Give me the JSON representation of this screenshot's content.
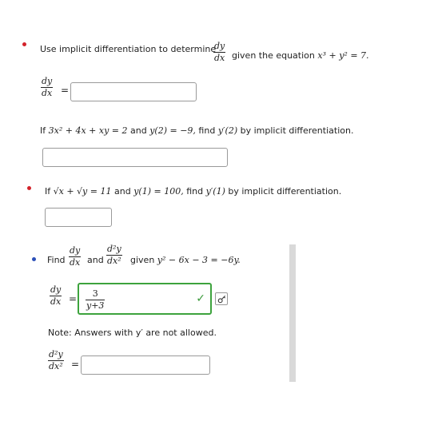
{
  "colors": {
    "dot_red": "#d3222a",
    "dot_blue": "#2b4fb8",
    "correct_green": "#3da33d",
    "scrollbar": "#d9d9d9"
  },
  "q1": {
    "prefix": "Use implicit differentiation to determine",
    "frac_num": "dy",
    "frac_den": "dx",
    "suffix": "given the equation",
    "equation": "x³ + y² = 7.",
    "answer_lhs_num": "dy",
    "answer_lhs_den": "dx",
    "answer_value": ""
  },
  "q2": {
    "text_a": "If",
    "equation": "3x² + 4x + xy = 2",
    "text_b": "and",
    "condition": "y(2) = −9,",
    "text_c": "find",
    "target": "y′(2)",
    "text_d": "by implicit differentiation.",
    "answer_value": ""
  },
  "q3": {
    "text_a": "If",
    "equation": "√x + √y = 11",
    "text_b": "and",
    "condition": "y(1) = 100,",
    "text_c": "find",
    "target": "y′(1)",
    "text_d": "by implicit differentiation.",
    "answer_value": ""
  },
  "q4": {
    "find_label": "Find",
    "d1_num": "dy",
    "d1_den": "dx",
    "and_label": "and",
    "d2_num": "d²y",
    "d2_den": "dx²",
    "given_label": "given",
    "equation": "y² − 6x − 3 = −6y.",
    "answer1_num": "3",
    "answer1_den": "y+3",
    "note": "Note: Answers with y′ are not allowed.",
    "answer2_value": "",
    "check_icon": "checkmark-icon",
    "key_icon": "key-icon"
  }
}
